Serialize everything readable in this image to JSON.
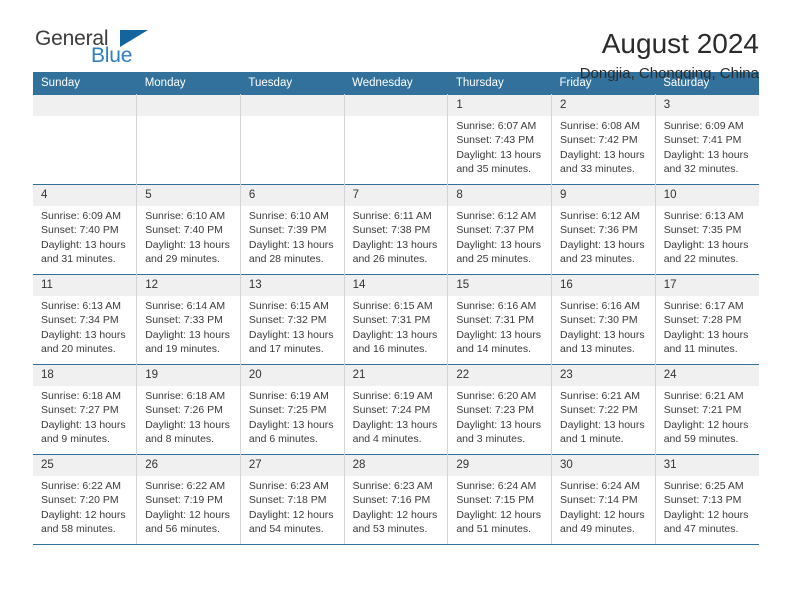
{
  "brand": {
    "name_part1": "General",
    "name_part2": "Blue",
    "triangle_icon": "triangle-icon",
    "accent_color": "#2f7fc4",
    "triangle_color": "#14659f"
  },
  "header": {
    "title": "August 2024",
    "location": "Dongjia, Chongqing, China"
  },
  "calendar": {
    "header_bg": "#31719b",
    "daynum_bg": "#f0f0f0",
    "weekdays": [
      "Sunday",
      "Monday",
      "Tuesday",
      "Wednesday",
      "Thursday",
      "Friday",
      "Saturday"
    ],
    "weeks": [
      [
        {
          "day": "",
          "empty": true
        },
        {
          "day": "",
          "empty": true
        },
        {
          "day": "",
          "empty": true
        },
        {
          "day": "",
          "empty": true
        },
        {
          "day": "1",
          "sunrise": "Sunrise: 6:07 AM",
          "sunset": "Sunset: 7:43 PM",
          "daylight1": "Daylight: 13 hours",
          "daylight2": "and 35 minutes."
        },
        {
          "day": "2",
          "sunrise": "Sunrise: 6:08 AM",
          "sunset": "Sunset: 7:42 PM",
          "daylight1": "Daylight: 13 hours",
          "daylight2": "and 33 minutes."
        },
        {
          "day": "3",
          "sunrise": "Sunrise: 6:09 AM",
          "sunset": "Sunset: 7:41 PM",
          "daylight1": "Daylight: 13 hours",
          "daylight2": "and 32 minutes."
        }
      ],
      [
        {
          "day": "4",
          "sunrise": "Sunrise: 6:09 AM",
          "sunset": "Sunset: 7:40 PM",
          "daylight1": "Daylight: 13 hours",
          "daylight2": "and 31 minutes."
        },
        {
          "day": "5",
          "sunrise": "Sunrise: 6:10 AM",
          "sunset": "Sunset: 7:40 PM",
          "daylight1": "Daylight: 13 hours",
          "daylight2": "and 29 minutes."
        },
        {
          "day": "6",
          "sunrise": "Sunrise: 6:10 AM",
          "sunset": "Sunset: 7:39 PM",
          "daylight1": "Daylight: 13 hours",
          "daylight2": "and 28 minutes."
        },
        {
          "day": "7",
          "sunrise": "Sunrise: 6:11 AM",
          "sunset": "Sunset: 7:38 PM",
          "daylight1": "Daylight: 13 hours",
          "daylight2": "and 26 minutes."
        },
        {
          "day": "8",
          "sunrise": "Sunrise: 6:12 AM",
          "sunset": "Sunset: 7:37 PM",
          "daylight1": "Daylight: 13 hours",
          "daylight2": "and 25 minutes."
        },
        {
          "day": "9",
          "sunrise": "Sunrise: 6:12 AM",
          "sunset": "Sunset: 7:36 PM",
          "daylight1": "Daylight: 13 hours",
          "daylight2": "and 23 minutes."
        },
        {
          "day": "10",
          "sunrise": "Sunrise: 6:13 AM",
          "sunset": "Sunset: 7:35 PM",
          "daylight1": "Daylight: 13 hours",
          "daylight2": "and 22 minutes."
        }
      ],
      [
        {
          "day": "11",
          "sunrise": "Sunrise: 6:13 AM",
          "sunset": "Sunset: 7:34 PM",
          "daylight1": "Daylight: 13 hours",
          "daylight2": "and 20 minutes."
        },
        {
          "day": "12",
          "sunrise": "Sunrise: 6:14 AM",
          "sunset": "Sunset: 7:33 PM",
          "daylight1": "Daylight: 13 hours",
          "daylight2": "and 19 minutes."
        },
        {
          "day": "13",
          "sunrise": "Sunrise: 6:15 AM",
          "sunset": "Sunset: 7:32 PM",
          "daylight1": "Daylight: 13 hours",
          "daylight2": "and 17 minutes."
        },
        {
          "day": "14",
          "sunrise": "Sunrise: 6:15 AM",
          "sunset": "Sunset: 7:31 PM",
          "daylight1": "Daylight: 13 hours",
          "daylight2": "and 16 minutes."
        },
        {
          "day": "15",
          "sunrise": "Sunrise: 6:16 AM",
          "sunset": "Sunset: 7:31 PM",
          "daylight1": "Daylight: 13 hours",
          "daylight2": "and 14 minutes."
        },
        {
          "day": "16",
          "sunrise": "Sunrise: 6:16 AM",
          "sunset": "Sunset: 7:30 PM",
          "daylight1": "Daylight: 13 hours",
          "daylight2": "and 13 minutes."
        },
        {
          "day": "17",
          "sunrise": "Sunrise: 6:17 AM",
          "sunset": "Sunset: 7:28 PM",
          "daylight1": "Daylight: 13 hours",
          "daylight2": "and 11 minutes."
        }
      ],
      [
        {
          "day": "18",
          "sunrise": "Sunrise: 6:18 AM",
          "sunset": "Sunset: 7:27 PM",
          "daylight1": "Daylight: 13 hours",
          "daylight2": "and 9 minutes."
        },
        {
          "day": "19",
          "sunrise": "Sunrise: 6:18 AM",
          "sunset": "Sunset: 7:26 PM",
          "daylight1": "Daylight: 13 hours",
          "daylight2": "and 8 minutes."
        },
        {
          "day": "20",
          "sunrise": "Sunrise: 6:19 AM",
          "sunset": "Sunset: 7:25 PM",
          "daylight1": "Daylight: 13 hours",
          "daylight2": "and 6 minutes."
        },
        {
          "day": "21",
          "sunrise": "Sunrise: 6:19 AM",
          "sunset": "Sunset: 7:24 PM",
          "daylight1": "Daylight: 13 hours",
          "daylight2": "and 4 minutes."
        },
        {
          "day": "22",
          "sunrise": "Sunrise: 6:20 AM",
          "sunset": "Sunset: 7:23 PM",
          "daylight1": "Daylight: 13 hours",
          "daylight2": "and 3 minutes."
        },
        {
          "day": "23",
          "sunrise": "Sunrise: 6:21 AM",
          "sunset": "Sunset: 7:22 PM",
          "daylight1": "Daylight: 13 hours",
          "daylight2": "and 1 minute."
        },
        {
          "day": "24",
          "sunrise": "Sunrise: 6:21 AM",
          "sunset": "Sunset: 7:21 PM",
          "daylight1": "Daylight: 12 hours",
          "daylight2": "and 59 minutes."
        }
      ],
      [
        {
          "day": "25",
          "sunrise": "Sunrise: 6:22 AM",
          "sunset": "Sunset: 7:20 PM",
          "daylight1": "Daylight: 12 hours",
          "daylight2": "and 58 minutes."
        },
        {
          "day": "26",
          "sunrise": "Sunrise: 6:22 AM",
          "sunset": "Sunset: 7:19 PM",
          "daylight1": "Daylight: 12 hours",
          "daylight2": "and 56 minutes."
        },
        {
          "day": "27",
          "sunrise": "Sunrise: 6:23 AM",
          "sunset": "Sunset: 7:18 PM",
          "daylight1": "Daylight: 12 hours",
          "daylight2": "and 54 minutes."
        },
        {
          "day": "28",
          "sunrise": "Sunrise: 6:23 AM",
          "sunset": "Sunset: 7:16 PM",
          "daylight1": "Daylight: 12 hours",
          "daylight2": "and 53 minutes."
        },
        {
          "day": "29",
          "sunrise": "Sunrise: 6:24 AM",
          "sunset": "Sunset: 7:15 PM",
          "daylight1": "Daylight: 12 hours",
          "daylight2": "and 51 minutes."
        },
        {
          "day": "30",
          "sunrise": "Sunrise: 6:24 AM",
          "sunset": "Sunset: 7:14 PM",
          "daylight1": "Daylight: 12 hours",
          "daylight2": "and 49 minutes."
        },
        {
          "day": "31",
          "sunrise": "Sunrise: 6:25 AM",
          "sunset": "Sunset: 7:13 PM",
          "daylight1": "Daylight: 12 hours",
          "daylight2": "and 47 minutes."
        }
      ]
    ]
  }
}
